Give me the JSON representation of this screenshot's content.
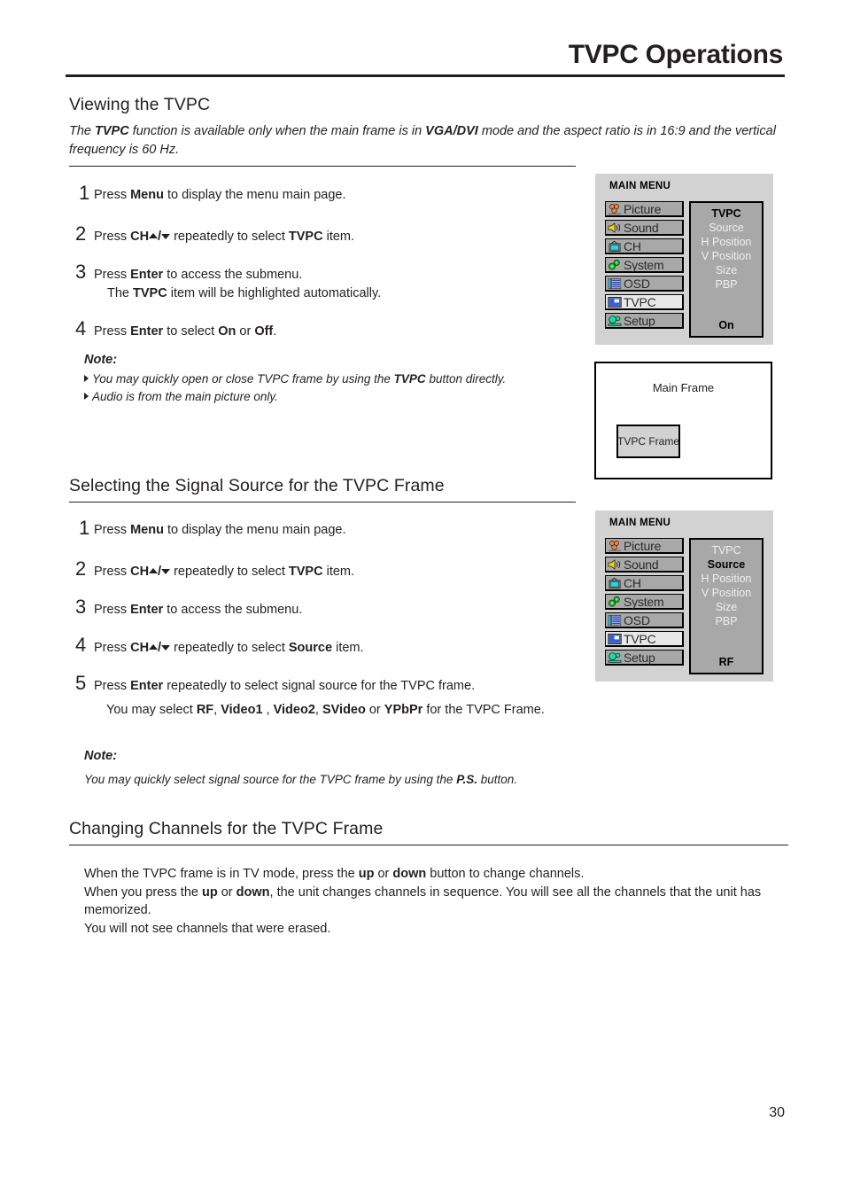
{
  "page": {
    "title": "TVPC Operations",
    "number": "30"
  },
  "sections": [
    {
      "heading": "Viewing the TVPC",
      "intro_before": "The ",
      "intro_bold1": "TVPC",
      "intro_mid1": " function is available only when the main frame is in ",
      "intro_bold2": "VGA/DVI",
      "intro_end": " mode and the aspect ratio is in 16:9 and the vertical frequency is 60 Hz."
    },
    {
      "heading": "Selecting the Signal Source for the TVPC Frame"
    },
    {
      "heading": "Changing Channels for the TVPC Frame"
    }
  ],
  "steps1": [
    {
      "num": "1",
      "a": "Press  ",
      "b": "Menu",
      "c": " to display the menu main page."
    },
    {
      "num": "2",
      "a": "Press ",
      "b": "CH",
      "arrows": true,
      "c": " repeatedly to select ",
      "d": "TVPC",
      "e": " item."
    },
    {
      "num": "3",
      "a": "Press ",
      "b": "Enter",
      "c": " to access the submenu.",
      "sub_a": "The ",
      "sub_b": "TVPC",
      "sub_c": "  item will be highlighted automatically."
    },
    {
      "num": "4",
      "a": "Press ",
      "b": "Enter",
      "c": " to select ",
      "d": "On",
      "e": " or ",
      "f": "Off",
      "g": "."
    }
  ],
  "note1": {
    "label": "Note:",
    "lines": [
      {
        "a": "You may quickly open or close TVPC  frame by using the ",
        "b": "TVPC",
        "c": " button directly."
      },
      {
        "a": "Audio is from the main picture only."
      }
    ]
  },
  "steps2": [
    {
      "num": "1",
      "a": "Press  ",
      "b": "Menu",
      "c": " to display the menu main page."
    },
    {
      "num": "2",
      "a": "Press ",
      "b": "CH",
      "arrows": true,
      "c": " repeatedly to select ",
      "d": "TVPC",
      "e": " item."
    },
    {
      "num": "3",
      "a": "Press ",
      "b": "Enter",
      "c": " to access the submenu."
    },
    {
      "num": "4",
      "a": "Press ",
      "b": "CH",
      "arrows": true,
      "c": " repeatedly to select ",
      "d": "Source",
      "e": " item."
    },
    {
      "num": "5",
      "a": "Press ",
      "b": "Enter",
      "c": " repeatedly to select signal source for the TVPC frame.",
      "sub": {
        "p1": "You may select ",
        "s1": "RF",
        "p2": ", ",
        "s2": "Video1",
        "p3": " , ",
        "s3": "Video2",
        "p4": ", ",
        "s4": "SVideo",
        "p5": " or ",
        "s5": "YPbPr",
        "p6": " for the TVPC Frame."
      }
    }
  ],
  "note2": {
    "label": "Note:",
    "line": {
      "a": "You may quickly select signal source for the TVPC frame by using the ",
      "b": "P.S.",
      "c": " button."
    }
  },
  "body3": {
    "l1a": "When the TVPC frame is in TV mode, press the ",
    "l1b": "up",
    "l1c": " or ",
    "l1d": "down",
    "l1e": " button to change channels.",
    "l2a": "When you press the ",
    "l2b": "up",
    "l2c": " or ",
    "l2d": "down",
    "l2e": ", the unit changes channels in sequence. You will see all the channels that the unit has memorized.",
    "l3": "You will not see channels that were erased."
  },
  "osd1": {
    "heading": "MAIN MENU",
    "items": [
      {
        "label": "Picture",
        "icon": "picture-icon",
        "selected": false
      },
      {
        "label": "Sound",
        "icon": "sound-icon",
        "selected": false
      },
      {
        "label": "CH",
        "icon": "tv-icon",
        "selected": false
      },
      {
        "label": "System",
        "icon": "system-icon",
        "selected": false
      },
      {
        "label": "OSD",
        "icon": "osd-icon",
        "selected": false
      },
      {
        "label": "TVPC",
        "icon": "tvpc-icon",
        "selected": true
      },
      {
        "label": "Setup",
        "icon": "setup-icon",
        "selected": false
      }
    ],
    "submenu": {
      "title": "TVPC",
      "title_active": true,
      "items": [
        "Source",
        "H Position",
        "V Position",
        "Size",
        "PBP"
      ],
      "active_item": "",
      "value": "On"
    }
  },
  "osd2": {
    "heading": "MAIN MENU",
    "items": [
      {
        "label": "Picture",
        "icon": "picture-icon",
        "selected": false
      },
      {
        "label": "Sound",
        "icon": "sound-icon",
        "selected": false
      },
      {
        "label": "CH",
        "icon": "tv-icon",
        "selected": false
      },
      {
        "label": "System",
        "icon": "system-icon",
        "selected": false
      },
      {
        "label": "OSD",
        "icon": "osd-icon",
        "selected": false
      },
      {
        "label": "TVPC",
        "icon": "tvpc-icon",
        "selected": true
      },
      {
        "label": "Setup",
        "icon": "setup-icon",
        "selected": false
      }
    ],
    "submenu": {
      "title": "TVPC",
      "title_active": false,
      "items": [
        "Source",
        "H Position",
        "V Position",
        "Size",
        "PBP"
      ],
      "active_item": "Source",
      "value": "RF"
    }
  },
  "frame_diagram": {
    "main_label": "Main Frame",
    "inner_label": "TVPC Frame"
  },
  "colors": {
    "osd_panel": "#d2d2d2",
    "osd_item": "#a8a8a8",
    "osd_item_selected": "#e8e8e8",
    "ink": "#231f20",
    "picture_icon": "#f08040",
    "sound_icon": "#f5d800",
    "tv_icon": "#20d8e8",
    "system_icon": "#10c820",
    "osd_icon": "#30c8e8",
    "tvpc_icon": "#3060e0",
    "setup_icon": "#10e0a0"
  }
}
